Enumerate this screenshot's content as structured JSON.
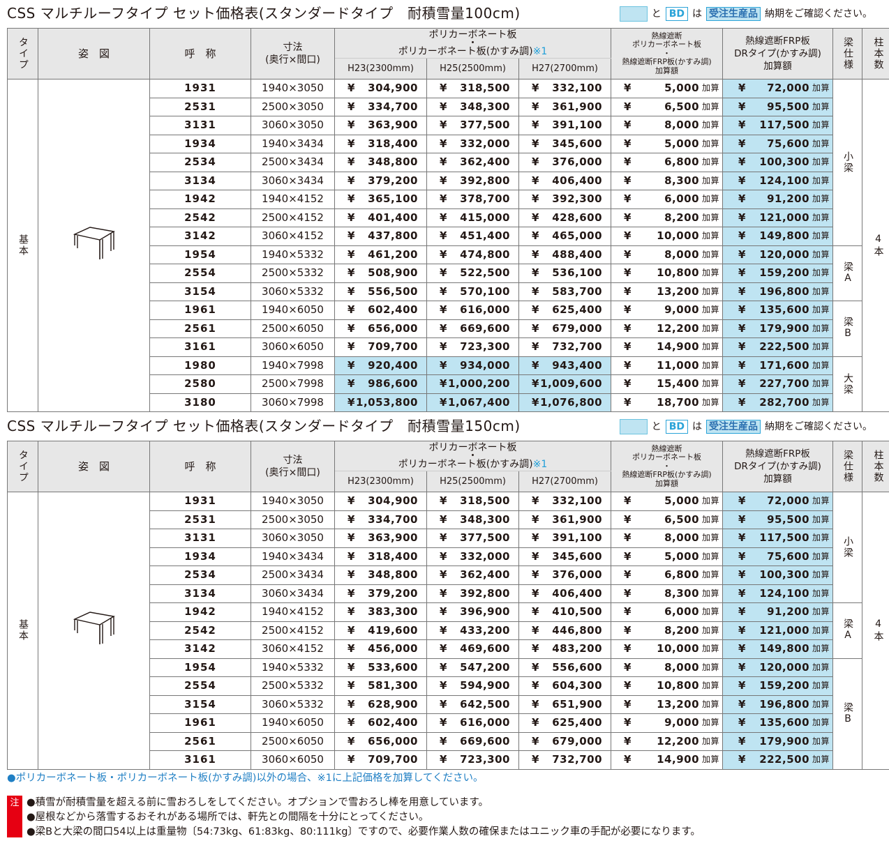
{
  "legend": {
    "and": "と",
    "bd": "BD",
    "ha": "は",
    "order": "受注生産品",
    "tail": "納期をご確認ください。"
  },
  "headers": {
    "type": "タイプ",
    "figure": "姿　図",
    "name": "呼　称",
    "size_line1": "寸法",
    "size_line2": "(奥行×間口)",
    "poly_line1": "ポリカーボネート板",
    "poly_line2": "・",
    "poly_line3": "ポリカーボネート板(かすみ調)",
    "poly_mark": "※1",
    "h23": "H23(2300mm)",
    "h25": "H25(2500mm)",
    "h27": "H27(2700mm)",
    "heat_line1": "熱線遮断",
    "heat_line2": "ポリカーボネート板",
    "heat_line3": "・",
    "heat_line4": "熱線遮断FRP板(かすみ調)",
    "heat_line5": "加算額",
    "frp_line1": "熱線遮断FRP板",
    "frp_line2": "DRタイプ(かすみ調)",
    "frp_line3": "加算額",
    "beam": "梁仕様",
    "posts": "柱本数"
  },
  "tables": [
    {
      "title": "CSS マルチルーフタイプ セット価格表(スタンダードタイプ　耐積雪量100cm)",
      "type": "基本",
      "posts": "4本",
      "beams": [
        {
          "label": "小梁",
          "rows": 9
        },
        {
          "label": "梁A",
          "rows": 3
        },
        {
          "label": "梁B",
          "rows": 3
        },
        {
          "label": "大梁",
          "rows": 3
        }
      ],
      "rows": [
        {
          "code": "1931",
          "size": "1940×3050",
          "h23": "304,900",
          "h25": "318,500",
          "h27": "332,100",
          "heat": "5,000",
          "frp": "72,000",
          "hl": false
        },
        {
          "code": "2531",
          "size": "2500×3050",
          "h23": "334,700",
          "h25": "348,300",
          "h27": "361,900",
          "heat": "6,500",
          "frp": "95,500",
          "hl": false
        },
        {
          "code": "3131",
          "size": "3060×3050",
          "h23": "363,900",
          "h25": "377,500",
          "h27": "391,100",
          "heat": "8,000",
          "frp": "117,500",
          "hl": false
        },
        {
          "code": "1934",
          "size": "1940×3434",
          "h23": "318,400",
          "h25": "332,000",
          "h27": "345,600",
          "heat": "5,000",
          "frp": "75,600",
          "hl": false
        },
        {
          "code": "2534",
          "size": "2500×3434",
          "h23": "348,800",
          "h25": "362,400",
          "h27": "376,000",
          "heat": "6,800",
          "frp": "100,300",
          "hl": false
        },
        {
          "code": "3134",
          "size": "3060×3434",
          "h23": "379,200",
          "h25": "392,800",
          "h27": "406,400",
          "heat": "8,300",
          "frp": "124,100",
          "hl": false
        },
        {
          "code": "1942",
          "size": "1940×4152",
          "h23": "365,100",
          "h25": "378,700",
          "h27": "392,300",
          "heat": "6,000",
          "frp": "91,200",
          "hl": false
        },
        {
          "code": "2542",
          "size": "2500×4152",
          "h23": "401,400",
          "h25": "415,000",
          "h27": "428,600",
          "heat": "8,200",
          "frp": "121,000",
          "hl": false
        },
        {
          "code": "3142",
          "size": "3060×4152",
          "h23": "437,800",
          "h25": "451,400",
          "h27": "465,000",
          "heat": "10,000",
          "frp": "149,800",
          "hl": false
        },
        {
          "code": "1954",
          "size": "1940×5332",
          "h23": "461,200",
          "h25": "474,800",
          "h27": "488,400",
          "heat": "8,000",
          "frp": "120,000",
          "hl": false
        },
        {
          "code": "2554",
          "size": "2500×5332",
          "h23": "508,900",
          "h25": "522,500",
          "h27": "536,100",
          "heat": "10,800",
          "frp": "159,200",
          "hl": false
        },
        {
          "code": "3154",
          "size": "3060×5332",
          "h23": "556,500",
          "h25": "570,100",
          "h27": "583,700",
          "heat": "13,200",
          "frp": "196,800",
          "hl": false
        },
        {
          "code": "1961",
          "size": "1940×6050",
          "h23": "602,400",
          "h25": "616,000",
          "h27": "625,400",
          "heat": "9,000",
          "frp": "135,600",
          "hl": false
        },
        {
          "code": "2561",
          "size": "2500×6050",
          "h23": "656,000",
          "h25": "669,600",
          "h27": "679,000",
          "heat": "12,200",
          "frp": "179,900",
          "hl": false
        },
        {
          "code": "3161",
          "size": "3060×6050",
          "h23": "709,700",
          "h25": "723,300",
          "h27": "732,700",
          "heat": "14,900",
          "frp": "222,500",
          "hl": false
        },
        {
          "code": "1980",
          "size": "1940×7998",
          "h23": "920,400",
          "h25": "934,000",
          "h27": "943,400",
          "heat": "11,000",
          "frp": "171,600",
          "hl": true
        },
        {
          "code": "2580",
          "size": "2500×7998",
          "h23": "986,600",
          "h25": "1,000,200",
          "h27": "1,009,600",
          "heat": "15,400",
          "frp": "227,700",
          "hl": true
        },
        {
          "code": "3180",
          "size": "3060×7998",
          "h23": "1,053,800",
          "h25": "1,067,400",
          "h27": "1,076,800",
          "heat": "18,700",
          "frp": "282,700",
          "hl": true
        }
      ]
    },
    {
      "title": "CSS マルチルーフタイプ セット価格表(スタンダードタイプ　耐積雪量150cm)",
      "type": "基本",
      "posts": "4本",
      "beams": [
        {
          "label": "小梁",
          "rows": 6
        },
        {
          "label": "梁A",
          "rows": 3
        },
        {
          "label": "梁B",
          "rows": 6
        }
      ],
      "rows": [
        {
          "code": "1931",
          "size": "1940×3050",
          "h23": "304,900",
          "h25": "318,500",
          "h27": "332,100",
          "heat": "5,000",
          "frp": "72,000",
          "hl": false
        },
        {
          "code": "2531",
          "size": "2500×3050",
          "h23": "334,700",
          "h25": "348,300",
          "h27": "361,900",
          "heat": "6,500",
          "frp": "95,500",
          "hl": false
        },
        {
          "code": "3131",
          "size": "3060×3050",
          "h23": "363,900",
          "h25": "377,500",
          "h27": "391,100",
          "heat": "8,000",
          "frp": "117,500",
          "hl": false
        },
        {
          "code": "1934",
          "size": "1940×3434",
          "h23": "318,400",
          "h25": "332,000",
          "h27": "345,600",
          "heat": "5,000",
          "frp": "75,600",
          "hl": false
        },
        {
          "code": "2534",
          "size": "2500×3434",
          "h23": "348,800",
          "h25": "362,400",
          "h27": "376,000",
          "heat": "6,800",
          "frp": "100,300",
          "hl": false
        },
        {
          "code": "3134",
          "size": "3060×3434",
          "h23": "379,200",
          "h25": "392,800",
          "h27": "406,400",
          "heat": "8,300",
          "frp": "124,100",
          "hl": false
        },
        {
          "code": "1942",
          "size": "1940×4152",
          "h23": "383,300",
          "h25": "396,900",
          "h27": "410,500",
          "heat": "6,000",
          "frp": "91,200",
          "hl": false
        },
        {
          "code": "2542",
          "size": "2500×4152",
          "h23": "419,600",
          "h25": "433,200",
          "h27": "446,800",
          "heat": "8,200",
          "frp": "121,000",
          "hl": false
        },
        {
          "code": "3142",
          "size": "3060×4152",
          "h23": "456,000",
          "h25": "469,600",
          "h27": "483,200",
          "heat": "10,000",
          "frp": "149,800",
          "hl": false
        },
        {
          "code": "1954",
          "size": "1940×5332",
          "h23": "533,600",
          "h25": "547,200",
          "h27": "556,600",
          "heat": "8,000",
          "frp": "120,000",
          "hl": false
        },
        {
          "code": "2554",
          "size": "2500×5332",
          "h23": "581,300",
          "h25": "594,900",
          "h27": "604,300",
          "heat": "10,800",
          "frp": "159,200",
          "hl": false
        },
        {
          "code": "3154",
          "size": "3060×5332",
          "h23": "628,900",
          "h25": "642,500",
          "h27": "651,900",
          "heat": "13,200",
          "frp": "196,800",
          "hl": false
        },
        {
          "code": "1961",
          "size": "1940×6050",
          "h23": "602,400",
          "h25": "616,000",
          "h27": "625,400",
          "heat": "9,000",
          "frp": "135,600",
          "hl": false
        },
        {
          "code": "2561",
          "size": "2500×6050",
          "h23": "656,000",
          "h25": "669,600",
          "h27": "679,000",
          "heat": "12,200",
          "frp": "179,900",
          "hl": false
        },
        {
          "code": "3161",
          "size": "3060×6050",
          "h23": "709,700",
          "h25": "723,300",
          "h27": "732,700",
          "heat": "14,900",
          "frp": "222,500",
          "hl": false
        }
      ]
    }
  ],
  "yen": "¥",
  "add_unit": "加算",
  "notes": {
    "blue": "●ポリカーボネート板・ポリカーボネート板(かすみ調)以外の場合、※1に上記価格を加算してください。",
    "mark": "注",
    "lines": [
      "●積雪が耐積雪量を超える前に雪おろしをしてください。オプションで雪おろし棒を用意しています。",
      "●屋根などから落雪するおそれがある場所では、軒先との間隔を十分にとってください。",
      "●梁Bと大梁の間口54以上は重量物〔54:73kg、61:83kg、80:111kg〕ですので、必要作業人数の確保またはユニック車の手配が必要になります。"
    ]
  }
}
